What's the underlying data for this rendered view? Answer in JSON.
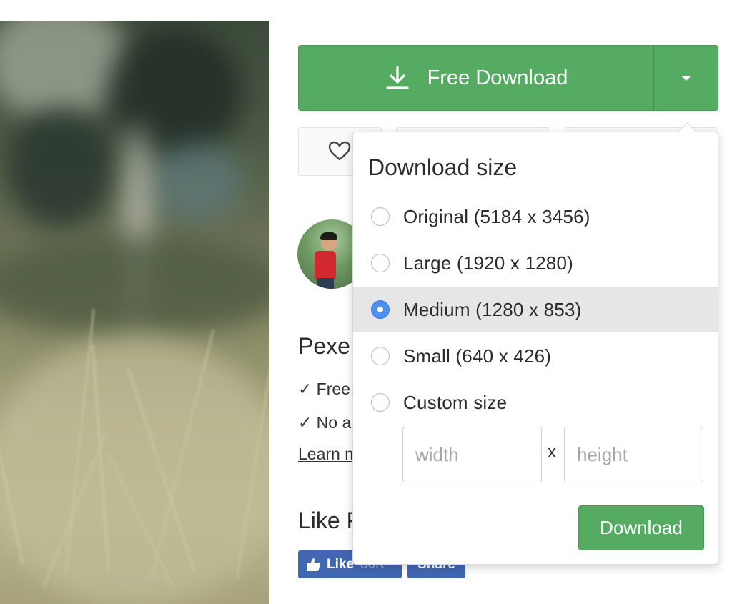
{
  "download": {
    "main_label": "Free Download",
    "icon": "download-icon",
    "caret_icon": "caret-down-icon",
    "color": "#55ab62"
  },
  "actions": {
    "like_icon": "heart-icon"
  },
  "sidebar": {
    "pexels_title_partial": "Pexe",
    "checks": [
      "✓ Free",
      "✓ No a"
    ],
    "learn_more_partial": "Learn m",
    "like_title_partial": "Like P",
    "facebook": {
      "like_label": "Like",
      "like_count": "80K",
      "share_label": "Share",
      "color": "#4267b2"
    }
  },
  "popover": {
    "title": "Download size",
    "options": [
      {
        "label": "Original (5184 x 3456)",
        "selected": false
      },
      {
        "label": "Large (1920 x 1280)",
        "selected": false
      },
      {
        "label": "Medium (1280 x 853)",
        "selected": true
      },
      {
        "label": "Small (640 x 426)",
        "selected": false
      },
      {
        "label": "Custom size",
        "selected": false
      }
    ],
    "width_placeholder": "width",
    "height_placeholder": "height",
    "separator": "x",
    "submit_label": "Download",
    "radio_accent": "#4e8ff2",
    "selected_row_bg": "#e6e6e6"
  }
}
